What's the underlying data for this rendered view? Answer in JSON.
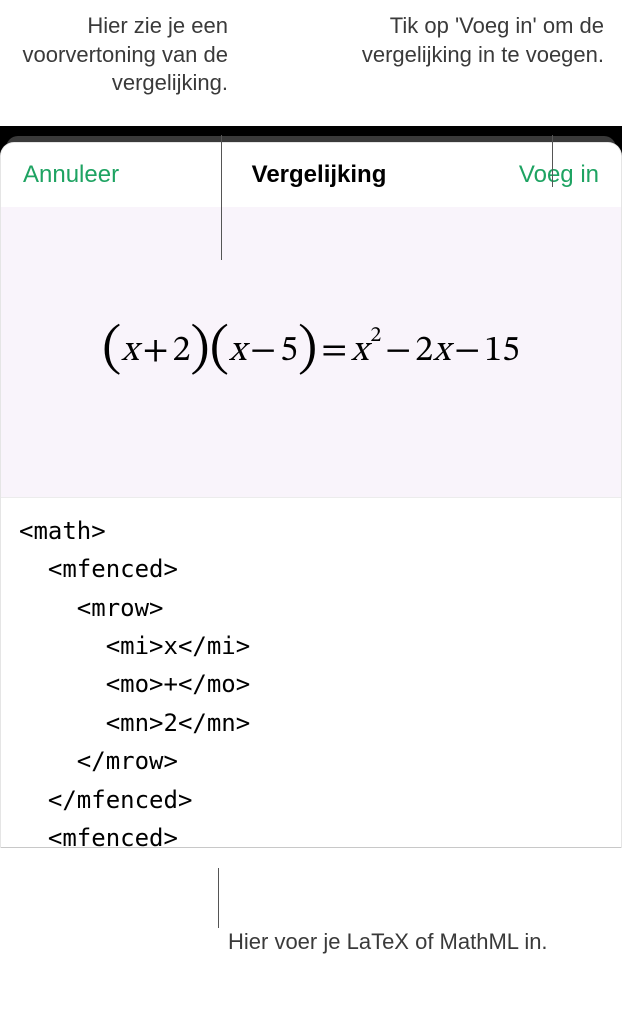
{
  "callouts": {
    "preview": "Hier zie je een voorvertoning van de vergelijking.",
    "insert": "Tik op 'Voeg in' om de vergelijking in te voegen.",
    "input": "Hier voer je LaTeX of MathML in."
  },
  "sheet": {
    "cancel_label": "Annuleer",
    "title": "Vergelijking",
    "insert_label": "Voeg in"
  },
  "equation": {
    "p1_open": "(",
    "p1_var": "x",
    "p1_op": "+",
    "p1_num": "2",
    "p1_close": ")",
    "p2_open": "(",
    "p2_var": "x",
    "p2_op": "−",
    "p2_num": "5",
    "p2_close": ")",
    "eq": "=",
    "r_var": "x",
    "r_exp": "2",
    "r_op1": "−",
    "r_t2c": "2",
    "r_t2v": "x",
    "r_op2": "−",
    "r_t3": "15"
  },
  "code": "<math>\n  <mfenced>\n    <mrow>\n      <mi>x</mi>\n      <mo>+</mo>\n      <mn>2</mn>\n    </mrow>\n  </mfenced>\n  <mfenced>\n    <mrow>"
}
